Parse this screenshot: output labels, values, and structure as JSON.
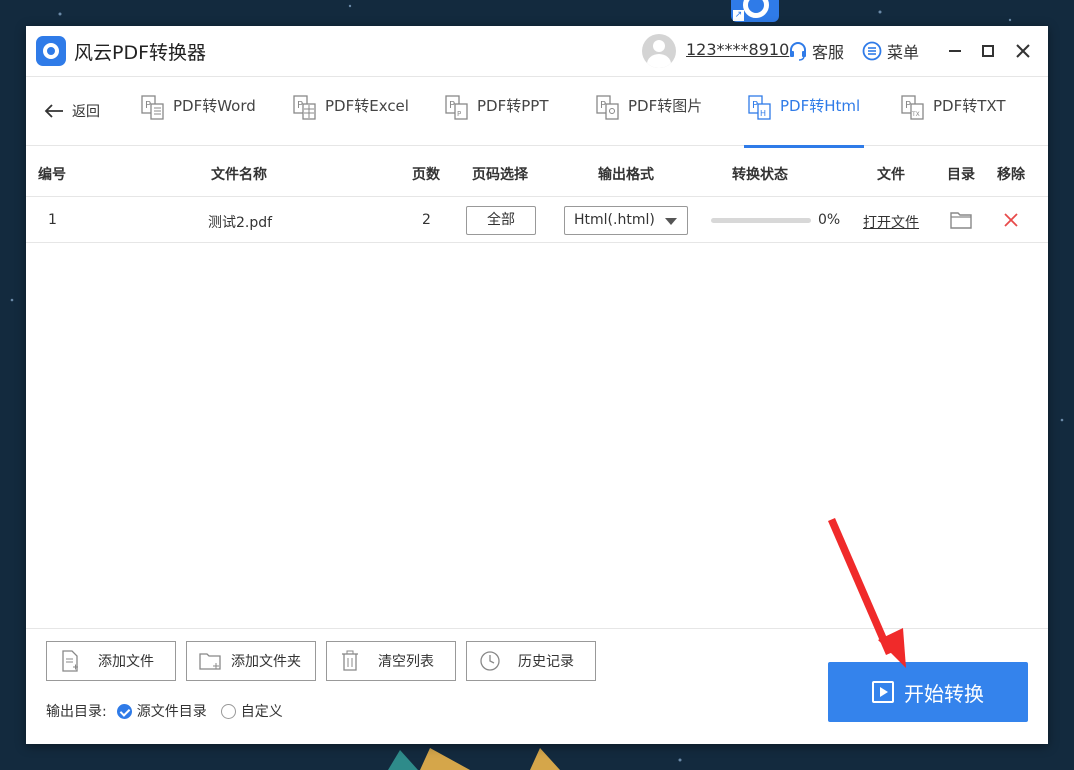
{
  "app": {
    "title": "风云PDF转换器",
    "user": "123****8910",
    "service_label": "客服",
    "menu_label": "菜单"
  },
  "nav": {
    "back_label": "返回",
    "tabs": [
      {
        "label": "PDF转Word"
      },
      {
        "label": "PDF转Excel"
      },
      {
        "label": "PDF转PPT"
      },
      {
        "label": "PDF转图片"
      },
      {
        "label": "PDF转Html"
      },
      {
        "label": "PDF转TXT"
      }
    ],
    "active_tab": "PDF转Html"
  },
  "table": {
    "headers": [
      "编号",
      "文件名称",
      "页数",
      "页码选择",
      "输出格式",
      "转换状态",
      "文件",
      "目录",
      "移除"
    ],
    "rows": [
      {
        "index": "1",
        "filename": "测试2.pdf",
        "pages": "2",
        "page_selection": "全部",
        "format": "Html(.html)",
        "progress_percent": 0,
        "progress_text": "0%",
        "open_file": "打开文件"
      }
    ]
  },
  "actions": {
    "add_file": "添加文件",
    "add_folder": "添加文件夹",
    "clear_list": "清空列表",
    "history": "历史记录"
  },
  "output": {
    "label": "输出目录:",
    "option_source": "源文件目录",
    "option_custom": "自定义",
    "selected": "源文件目录"
  },
  "start_button": "开始转换",
  "colors": {
    "accent": "#2f7be8",
    "start_button": "#3483ec",
    "remove": "#e84a4a",
    "annotation_arrow": "#f02a2a"
  }
}
